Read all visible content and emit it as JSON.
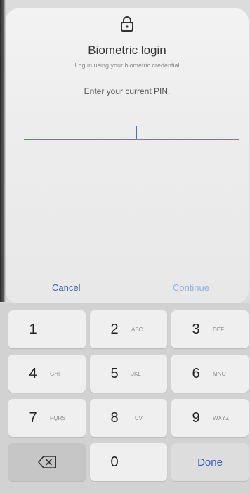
{
  "dialog": {
    "title": "Biometric login",
    "subtitle": "Log in using your biometric credential",
    "prompt": "Enter your current PIN.",
    "pin_value": "",
    "cancel_label": "Cancel",
    "continue_label": "Continue",
    "icons": {
      "lock": "lock-icon"
    }
  },
  "keypad": {
    "keys": [
      {
        "num": "1",
        "letters": ""
      },
      {
        "num": "2",
        "letters": "ABC"
      },
      {
        "num": "3",
        "letters": "DEF"
      },
      {
        "num": "4",
        "letters": "GHI"
      },
      {
        "num": "5",
        "letters": "JKL"
      },
      {
        "num": "6",
        "letters": "MNO"
      },
      {
        "num": "7",
        "letters": "PQRS"
      },
      {
        "num": "8",
        "letters": "TUV"
      },
      {
        "num": "9",
        "letters": "WXYZ"
      },
      {
        "num": "0",
        "letters": ""
      }
    ],
    "done_label": "Done",
    "backspace_icon": "backspace-icon"
  },
  "colors": {
    "accent": "#3c63b0",
    "accent_disabled": "#8fb3e2",
    "field_underline": "#5a83c9"
  }
}
